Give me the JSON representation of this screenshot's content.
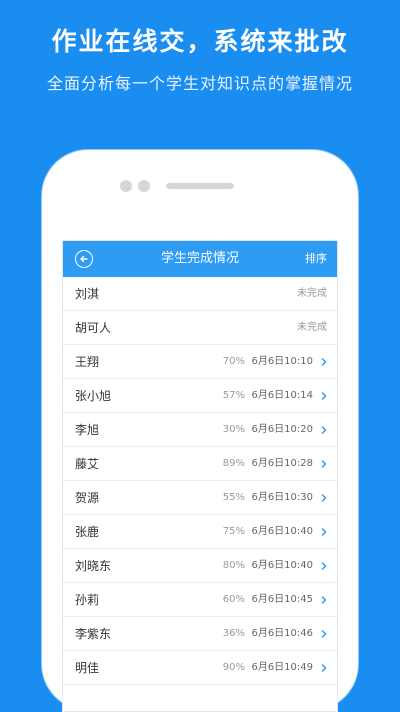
{
  "promo": {
    "title": "作业在线交，系统来批改",
    "subtitle": "全面分析每一个学生对知识点的掌握情况"
  },
  "header": {
    "back_icon": "back-arrow-circle-icon",
    "title": "学生完成情况",
    "sort_label": "排序"
  },
  "colors": {
    "background": "#1a8df0",
    "header": "#2e9cf3",
    "chevron": "#2e9cf3"
  },
  "students": [
    {
      "name": "刘淇",
      "status": "未完成"
    },
    {
      "name": "胡可人",
      "status": "未完成"
    },
    {
      "name": "王翔",
      "percent": "70%",
      "time": "6月6日10:10"
    },
    {
      "name": "张小旭",
      "percent": "57%",
      "time": "6月6日10:14"
    },
    {
      "name": "李旭",
      "percent": "30%",
      "time": "6月6日10:20"
    },
    {
      "name": "藤艾",
      "percent": "89%",
      "time": "6月6日10:28"
    },
    {
      "name": "贺源",
      "percent": "55%",
      "time": "6月6日10:30"
    },
    {
      "name": "张鹿",
      "percent": "75%",
      "time": "6月6日10:40"
    },
    {
      "name": "刘晓东",
      "percent": "80%",
      "time": "6月6日10:40"
    },
    {
      "name": "孙莉",
      "percent": "60%",
      "time": "6月6日10:45"
    },
    {
      "name": "李紫东",
      "percent": "36%",
      "time": "6月6日10:46"
    },
    {
      "name": "明佳",
      "percent": "90%",
      "time": "6月6日10:49"
    }
  ]
}
